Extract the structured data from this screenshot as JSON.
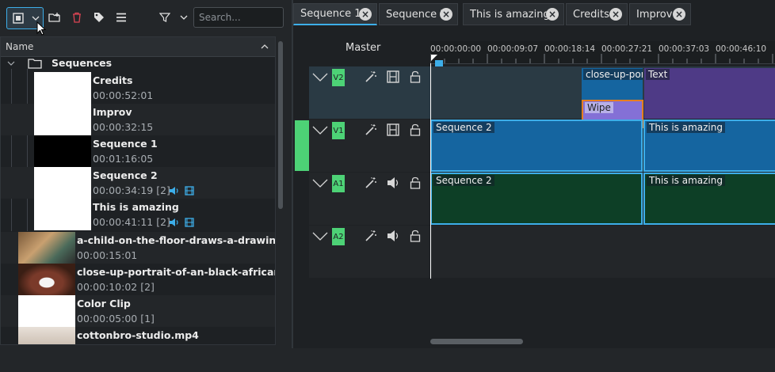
{
  "bin": {
    "search_placeholder": "Search...",
    "column_name": "Name",
    "folder_name": "Sequences",
    "sequence_items": [
      {
        "name": "Credits",
        "meta": "00:00:52:01",
        "thumb": "#ffffff"
      },
      {
        "name": "Improv",
        "meta": "00:00:32:15",
        "thumb": "#ffffff"
      },
      {
        "name": "Sequence 1",
        "meta": "00:01:16:05",
        "thumb": "#000000"
      },
      {
        "name": "Sequence 2",
        "meta": "00:00:34:19 [2]",
        "thumb": "#ffffff"
      },
      {
        "name": "This is amazing",
        "meta": "00:00:41:11 [2]",
        "thumb": "#ffffff"
      }
    ],
    "clip_items": [
      {
        "name": "a-child-on-the-floor-draws-a-drawing-w",
        "meta": "00:00:15:01"
      },
      {
        "name": "close-up-portrait-of-an-black-african-a",
        "meta": "00:00:10:02 [2]"
      },
      {
        "name": "Color Clip",
        "meta": "00:00:05:00 [1]"
      },
      {
        "name": "cottonbro-studio.mp4",
        "meta": ""
      }
    ]
  },
  "tabs": [
    {
      "label": "Sequence 1",
      "active": true
    },
    {
      "label": "Sequence 2",
      "active": false
    },
    {
      "label": "This is amazing",
      "active": false
    },
    {
      "label": "Credits",
      "active": false
    },
    {
      "label": "Improv",
      "active": false
    }
  ],
  "timeline": {
    "master_label": "Master",
    "ruler": [
      "00:00:00:00",
      "00:00:09:07",
      "00:00:18:14",
      "00:00:27:21",
      "00:00:37:03",
      "00:00:46:10"
    ],
    "tracks": [
      {
        "name": "V2"
      },
      {
        "name": "V1"
      },
      {
        "name": "A1"
      },
      {
        "name": "A2"
      }
    ],
    "clips": {
      "v2_portrait": "close-up-portrait-of",
      "v2_text": "Text",
      "v2_transition": "Wipe",
      "v1_seq2": "Sequence 2",
      "v1_amazing": "This is amazing",
      "a1_seq2": "Sequence 2",
      "a1_amazing": "This is amazing"
    }
  },
  "colors": {
    "accent": "#3daee9",
    "track_badge": "#4dd276",
    "video_clip": "#1565a0",
    "audio_clip": "#0d3f26",
    "text_clip": "#4e3a86",
    "transition": "#8470d6"
  }
}
